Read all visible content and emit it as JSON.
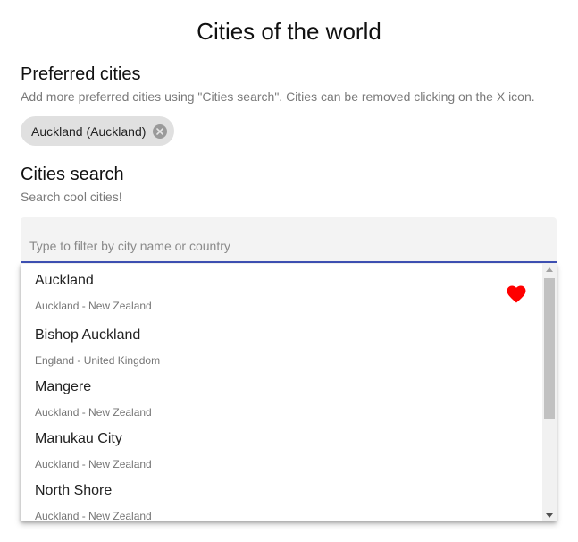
{
  "app": {
    "title": "Cities of the world"
  },
  "preferred": {
    "title": "Preferred cities",
    "subtitle": "Add more preferred cities using \"Cities search\". Cities can be removed clicking on the X icon.",
    "chips": [
      {
        "label": "Auckland (Auckland)",
        "icon": "close-circle-icon"
      }
    ]
  },
  "search": {
    "title": "Cities search",
    "subtitle": "Search cool cities!",
    "value": "",
    "placeholder": "Type to filter by city name or country",
    "accent_color": "#3f51b5"
  },
  "results": {
    "items": [
      {
        "name": "Auckland",
        "detail": "Auckland - New Zealand",
        "favorite": true
      },
      {
        "name": "Bishop Auckland",
        "detail": "England - United Kingdom",
        "favorite": false
      },
      {
        "name": "Mangere",
        "detail": "Auckland - New Zealand",
        "favorite": false
      },
      {
        "name": "Manukau City",
        "detail": "Auckland - New Zealand",
        "favorite": false
      },
      {
        "name": "North Shore",
        "detail": "Auckland - New Zealand",
        "favorite": false
      }
    ],
    "favorite_icon": "heart-icon",
    "favorite_color": "#ff0000"
  }
}
